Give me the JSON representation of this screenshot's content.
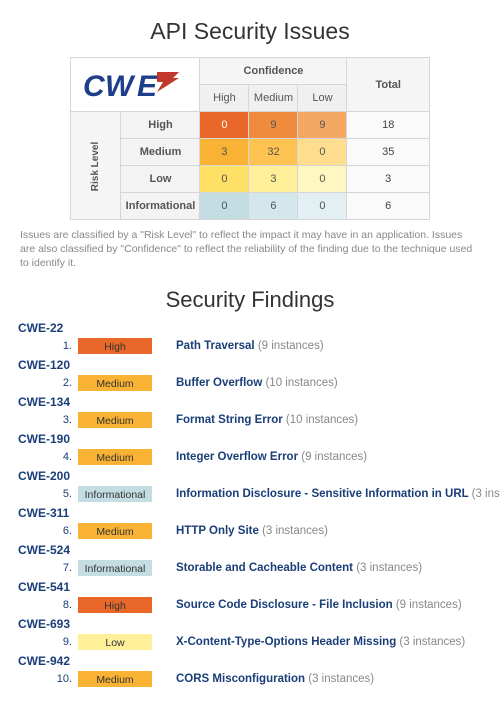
{
  "page_title": "API Security Issues",
  "axes": {
    "confidence_label": "Confidence",
    "risk_label": "Risk Level",
    "cols": [
      "High",
      "Medium",
      "Low",
      "Total"
    ],
    "rows": [
      "High",
      "Medium",
      "Low",
      "Informational"
    ]
  },
  "matrix": {
    "High": {
      "High": 0,
      "Medium": 9,
      "Low": 9,
      "Total": 18
    },
    "Medium": {
      "High": 3,
      "Medium": 32,
      "Low": 0,
      "Total": 35
    },
    "Low": {
      "High": 0,
      "Medium": 3,
      "Low": 0,
      "Total": 3
    },
    "Informational": {
      "High": 0,
      "Medium": 6,
      "Low": 0,
      "Total": 6
    }
  },
  "caption": "Issues are classified by a \"Risk Level\" to reflect the impact it may have in an application. Issues are also classified by \"Confidence\" to reflect the reliability of the finding due to the technique used to identify it.",
  "findings_title": "Security Findings",
  "risk_labels": {
    "High": "High",
    "Medium": "Medium",
    "Low": "Low",
    "Informational": "Informational"
  },
  "findings": [
    {
      "n": 1,
      "cwe": "CWE-22",
      "risk": "High",
      "title": "Path Traversal",
      "count": 9
    },
    {
      "n": 2,
      "cwe": "CWE-120",
      "risk": "Medium",
      "title": "Buffer Overflow",
      "count": 10
    },
    {
      "n": 3,
      "cwe": "CWE-134",
      "risk": "Medium",
      "title": "Format String Error",
      "count": 10
    },
    {
      "n": 4,
      "cwe": "CWE-190",
      "risk": "Medium",
      "title": "Integer Overflow Error",
      "count": 9
    },
    {
      "n": 5,
      "cwe": "CWE-200",
      "risk": "Informational",
      "title": "Information Disclosure - Sensitive Information in URL",
      "count": 3
    },
    {
      "n": 6,
      "cwe": "CWE-311",
      "risk": "Medium",
      "title": "HTTP Only Site",
      "count": 3
    },
    {
      "n": 7,
      "cwe": "CWE-524",
      "risk": "Informational",
      "title": "Storable and Cacheable Content",
      "count": 3
    },
    {
      "n": 8,
      "cwe": "CWE-541",
      "risk": "High",
      "title": "Source Code Disclosure - File Inclusion",
      "count": 9
    },
    {
      "n": 9,
      "cwe": "CWE-693",
      "risk": "Low",
      "title": "X-Content-Type-Options Header Missing",
      "count": 3
    },
    {
      "n": 10,
      "cwe": "CWE-942",
      "risk": "Medium",
      "title": "CORS Misconfiguration",
      "count": 3
    }
  ]
}
